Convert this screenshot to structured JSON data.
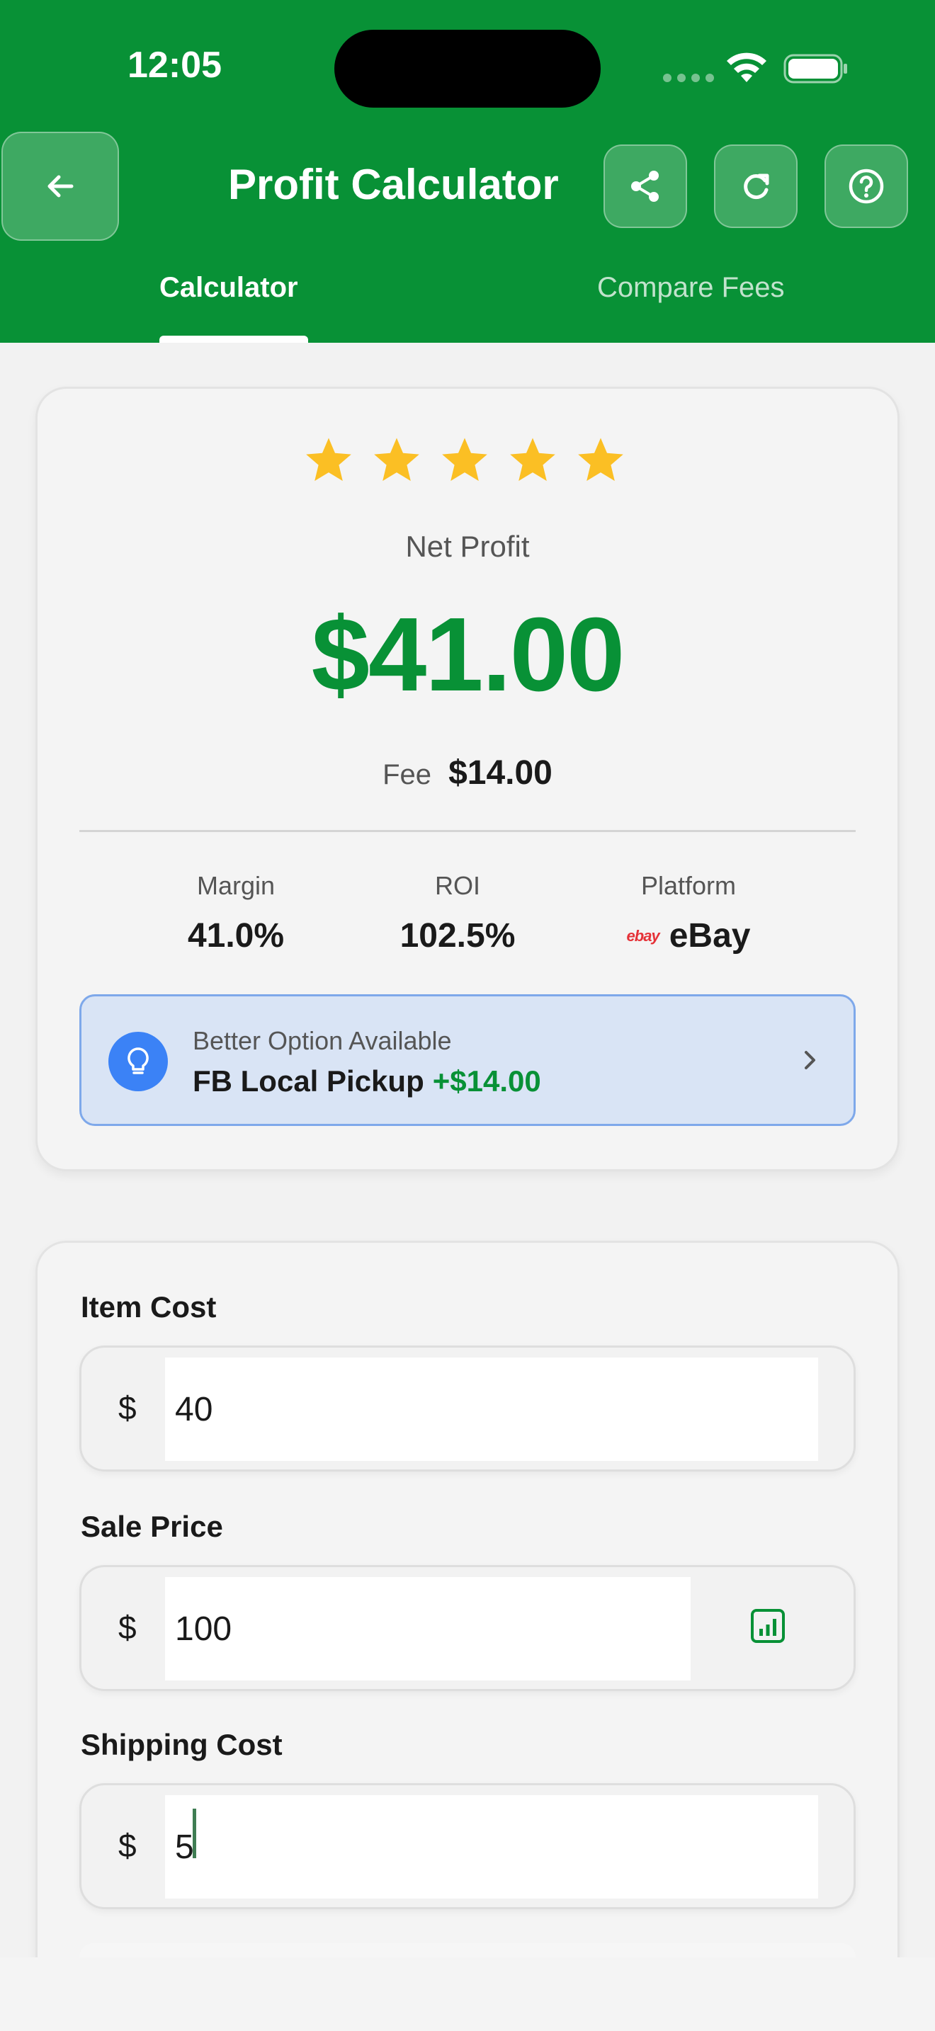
{
  "status_bar": {
    "time": "12:05"
  },
  "header": {
    "title": "Profit Calculator",
    "tabs": [
      {
        "label": "Calculator",
        "active": true
      },
      {
        "label": "Compare Fees",
        "active": false
      }
    ],
    "icons": [
      "arrow-left-icon",
      "share-icon",
      "refresh-icon",
      "help-icon"
    ]
  },
  "colors": {
    "brand": "#089136",
    "star": "#fbbf24",
    "info_bg": "#d9e4f5",
    "info_accent": "#3b82f6"
  },
  "result": {
    "rating_stars": 5,
    "net_profit_label": "Net Profit",
    "net_profit_value": "$41.00",
    "fee_label": "Fee",
    "fee_value": "$14.00",
    "stats": [
      {
        "label": "Margin",
        "value": "41.0%"
      },
      {
        "label": "ROI",
        "value": "102.5%"
      },
      {
        "label": "Platform",
        "value": "eBay",
        "logo_text": "ebay"
      }
    ],
    "better_option": {
      "title": "Better Option Available",
      "name": "FB Local Pickup",
      "delta": "+$14.00"
    }
  },
  "inputs": {
    "item_cost": {
      "label": "Item Cost",
      "currency": "$",
      "value": "40"
    },
    "sale_price": {
      "label": "Sale Price",
      "currency": "$",
      "value": "100"
    },
    "shipping_cost": {
      "label": "Shipping Cost",
      "currency": "$",
      "value": "5"
    }
  }
}
